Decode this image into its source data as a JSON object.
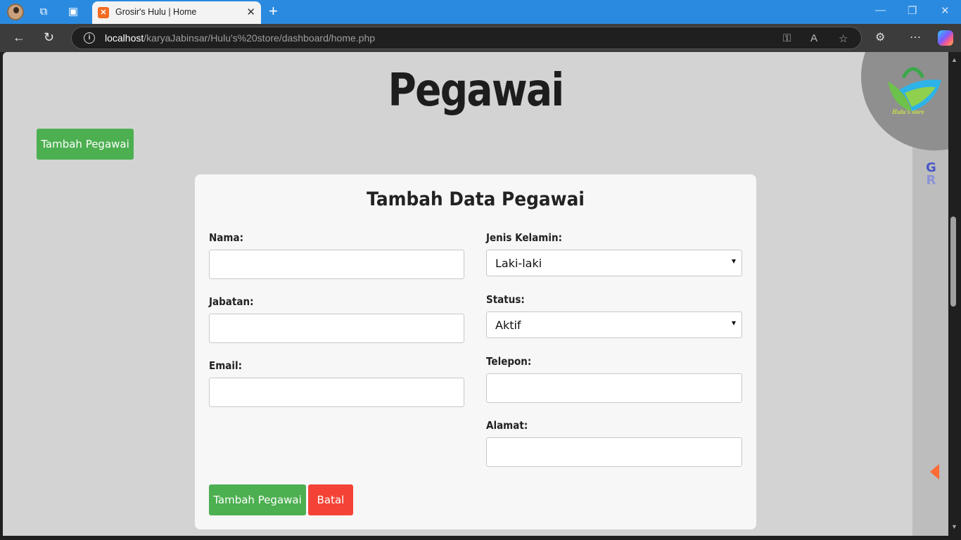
{
  "browser": {
    "tab_title": "Grosir's Hulu | Home",
    "url_host": "localhost",
    "url_path": "/karyaJabinsar/Hulu's%20store/dashboard/home.php"
  },
  "page": {
    "title": "Pegawai",
    "add_button": "Tambah Pegawai",
    "logo_text": "Hulu's store"
  },
  "form": {
    "title": "Tambah Data Pegawai",
    "nama_label": "Nama:",
    "jabatan_label": "Jabatan:",
    "email_label": "Email:",
    "jenis_kelamin_label": "Jenis Kelamin:",
    "jenis_kelamin_value": "Laki-laki",
    "status_label": "Status:",
    "status_value": "Aktif",
    "telepon_label": "Telepon:",
    "alamat_label": "Alamat:",
    "submit_label": "Tambah Pegawai",
    "cancel_label": "Batal"
  },
  "side": {
    "gr_top": "G",
    "gr_bottom": "R"
  },
  "colors": {
    "accent_green": "#4caf50",
    "danger_red": "#f44336",
    "page_bg": "#d3d3d3"
  }
}
